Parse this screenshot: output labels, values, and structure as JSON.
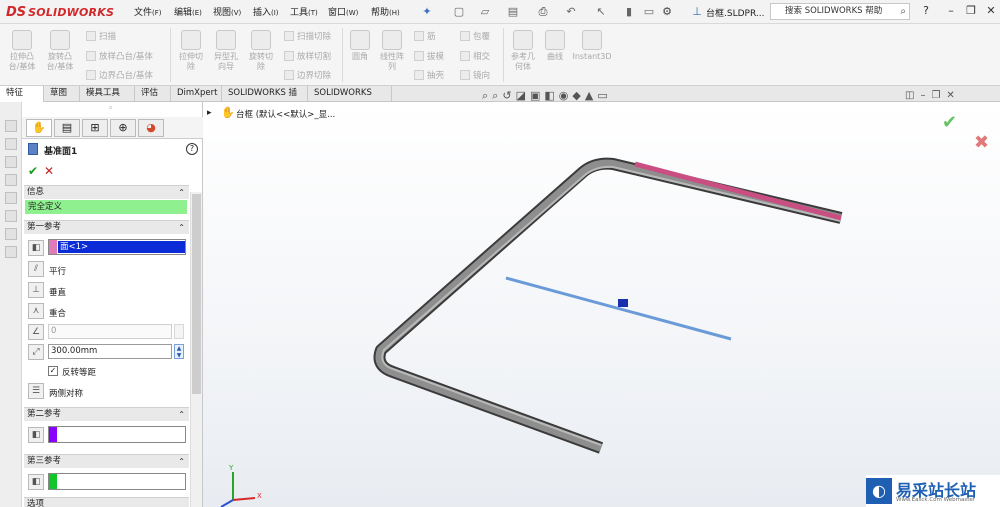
{
  "app": {
    "logo_ds": "DS",
    "logo_text": "SOLIDWORKS"
  },
  "menu": [
    {
      "label": "文件",
      "key": "(F)"
    },
    {
      "label": "编辑",
      "key": "(E)"
    },
    {
      "label": "视图",
      "key": "(V)"
    },
    {
      "label": "插入",
      "key": "(I)"
    },
    {
      "label": "工具",
      "key": "(T)"
    },
    {
      "label": "窗口",
      "key": "(W)"
    },
    {
      "label": "帮助",
      "key": "(H)"
    }
  ],
  "document": {
    "title": "台框.SLDPR..."
  },
  "help_search": {
    "placeholder": "搜索 SOLIDWORKS 帮助"
  },
  "ribbon": {
    "extrude_boss": "拉伸凸\n台/基体",
    "revolve_boss": "旋转凸\n台/基体",
    "sweep": "扫描",
    "loft_boss": "放样凸台/基体",
    "boundary_boss": "边界凸台/基体",
    "extrude_cut": "拉伸切\n除",
    "hole_wizard": "异型孔\n向导",
    "revolve_cut": "旋转切\n除",
    "sweep_cut": "扫描切除",
    "loft_cut": "放样切割",
    "boundary_cut": "边界切除",
    "fillet": "圆角",
    "linear_pattern": "线性阵\n列",
    "rib": "筋",
    "draft": "拔模",
    "shell": "抽壳",
    "wrap": "包覆",
    "intersect": "相交",
    "mirror": "镜向",
    "ref_geometry": "参考几\n何体",
    "curves": "曲线",
    "instant3d": "Instant3D"
  },
  "tabs": [
    "特征",
    "草图",
    "模具工具",
    "评估",
    "DimXpert",
    "SOLIDWORKS 插件",
    "SOLIDWORKS MBD"
  ],
  "feature_tree": {
    "root": "台框 (默认<<默认>_显..."
  },
  "property_manager": {
    "title": "基准面1",
    "help": "?",
    "ok": "✔",
    "cancel": "✕",
    "info_header": "信息",
    "info_status": "完全定义",
    "first_ref_header": "第一参考",
    "first_ref_value": "面<1>",
    "parallel": "平行",
    "perpendicular": "垂直",
    "coincident": "重合",
    "angle_value": "0",
    "offset_value": "300.00mm",
    "flip_offset": "反转等距",
    "flip_checked": true,
    "mid_plane": "两侧对称",
    "second_ref_header": "第二参考",
    "third_ref_header": "第三参考",
    "options_header": "选项"
  },
  "colors": {
    "ref1": "#e07ab8",
    "ref2": "#8a00ff",
    "ref3": "#12c62a",
    "info_ok": "#8ef08e",
    "selection": "#0a2bd6"
  },
  "watermark": {
    "text": "易采站长站",
    "sub": "Www.Easck.Com Webmaster"
  }
}
